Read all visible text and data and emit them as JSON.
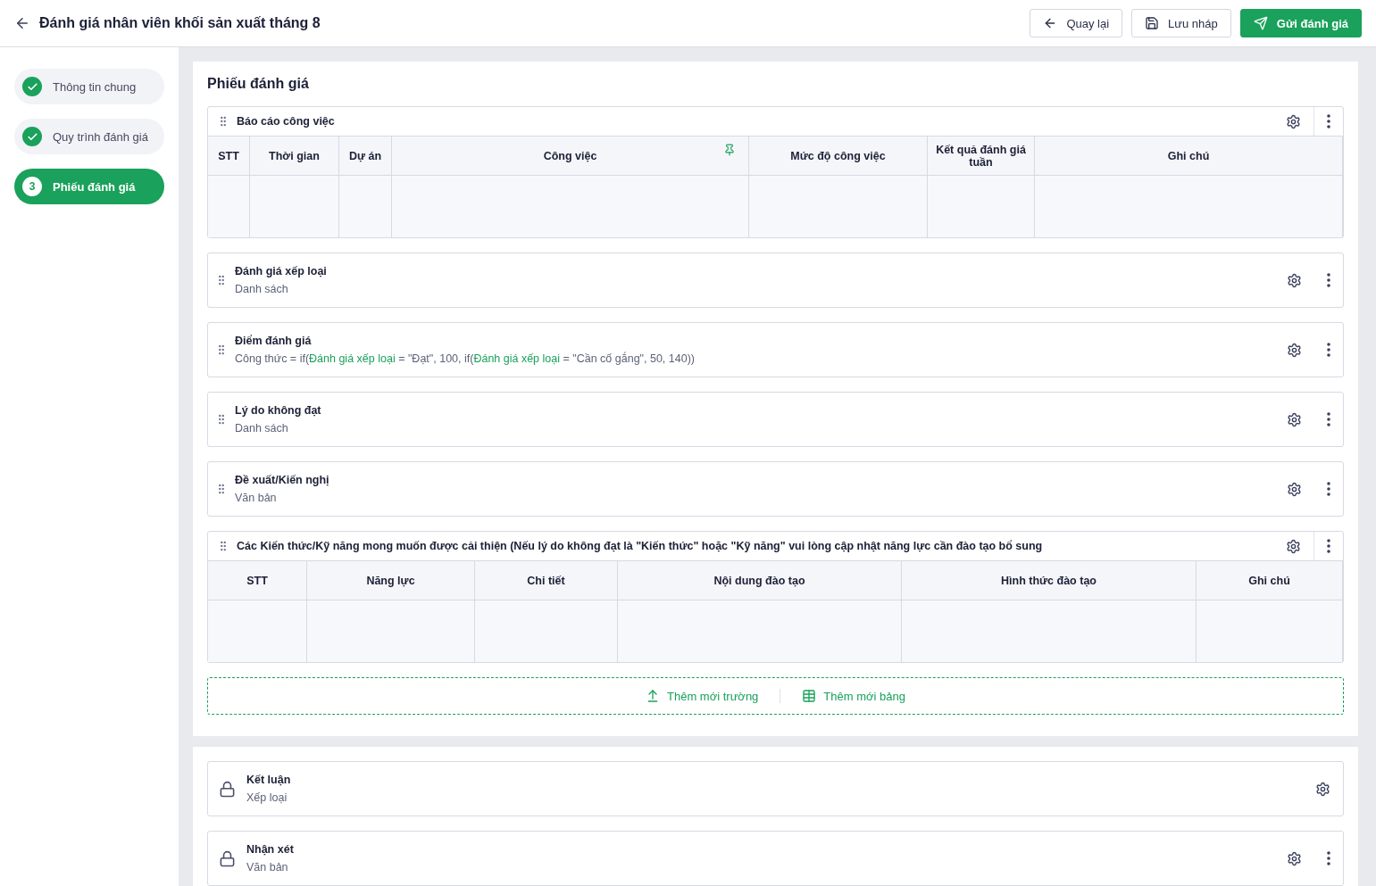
{
  "header": {
    "title": "Đánh giá nhân viên khối sản xuất tháng 8",
    "buttons": [
      {
        "label": "Quay lại",
        "kind": "back"
      },
      {
        "label": "Lưu nháp",
        "kind": "save"
      },
      {
        "label": "Gửi đánh giá",
        "kind": "send"
      }
    ]
  },
  "steps": [
    {
      "label": "Thông tin chung",
      "done": true,
      "selected": false
    },
    {
      "label": "Quy trình đánh giá",
      "done": true,
      "selected": false
    },
    {
      "label": "Phiếu đánh giá",
      "done": false,
      "number": "3",
      "selected": true
    }
  ],
  "form": {
    "title": "Phiếu đánh giá",
    "sections": [
      {
        "kind": "table",
        "title": "Báo cáo công việc",
        "columns": [
          {
            "label": "STT",
            "pinned": false
          },
          {
            "label": "Thời gian",
            "pinned": false
          },
          {
            "label": "Dự án",
            "pinned": false
          },
          {
            "label": "Công việc",
            "pinned": true
          },
          {
            "label": "Mức độ công việc",
            "pinned": false
          },
          {
            "label": "Kết quả đánh giá tuần",
            "pinned": false
          },
          {
            "label": "Ghi chú",
            "pinned": false
          }
        ]
      },
      {
        "kind": "field",
        "title": "Đánh giá xếp loại",
        "subtitle": [
          {
            "text": "Danh sách",
            "ref": false
          }
        ]
      },
      {
        "kind": "field",
        "title": "Điểm đánh giá",
        "subtitle": [
          {
            "text": "Công thức = if(",
            "ref": false
          },
          {
            "text": "Đánh giá xếp loại",
            "ref": true
          },
          {
            "text": " = \"Đạt\", 100, if(",
            "ref": false
          },
          {
            "text": "Đánh giá xếp loại",
            "ref": true
          },
          {
            "text": " = \"Cần cố gắng\", 50, 140))",
            "ref": false
          }
        ]
      },
      {
        "kind": "field",
        "title": "Lý do không đạt",
        "subtitle": [
          {
            "text": "Danh sách",
            "ref": false
          }
        ]
      },
      {
        "kind": "field",
        "title": "Đề xuất/Kiến nghị",
        "subtitle": [
          {
            "text": "Văn bản",
            "ref": false
          }
        ]
      },
      {
        "kind": "table",
        "title": "Các Kiến thức/Kỹ năng mong muốn được cải thiện (Nếu lý do không đạt là \"Kiến thức\" hoặc \"Kỹ năng\" vui lòng cập nhật năng lực cần đào tạo bổ sung",
        "columns": [
          {
            "label": "STT",
            "pinned": false
          },
          {
            "label": "Năng lực",
            "pinned": false
          },
          {
            "label": "Chi tiết",
            "pinned": false
          },
          {
            "label": "Nội dung đào tạo",
            "pinned": false
          },
          {
            "label": "Hình thức đào tạo",
            "pinned": false
          },
          {
            "label": "Ghi chú",
            "pinned": false
          }
        ]
      }
    ],
    "add_actions": [
      {
        "label": "Thêm mới trường",
        "kind": "field"
      },
      {
        "label": "Thêm mới bảng",
        "kind": "table"
      }
    ]
  },
  "locked_sections": [
    {
      "title": "Kết luận",
      "subtitle": "Xếp loại",
      "menu": false
    },
    {
      "title": "Nhận xét",
      "subtitle": "Văn bản",
      "menu": true
    }
  ]
}
